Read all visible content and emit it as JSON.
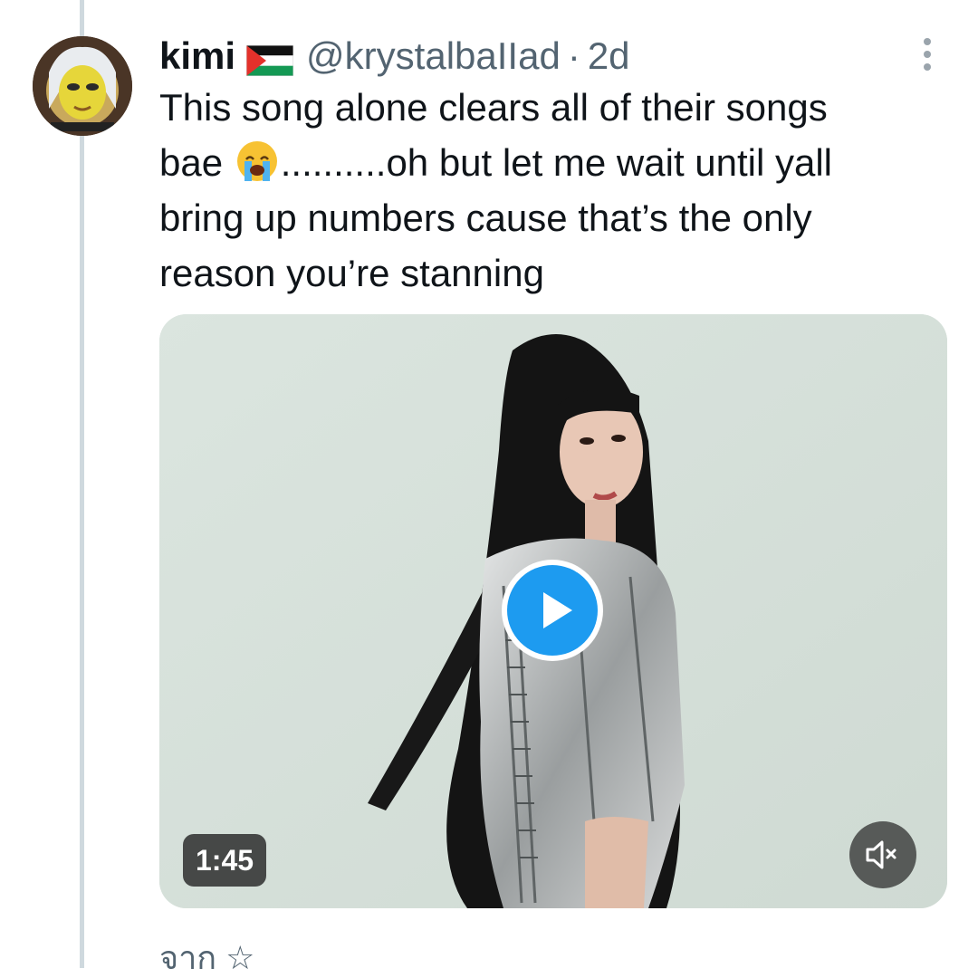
{
  "tweet": {
    "display_name": "kimi",
    "flag_icon": "palestine-flag-icon",
    "handle": "@krystalbaIIad",
    "separator": "·",
    "timestamp": "2d",
    "text_lines": [
      "This song alone clears all of their songs",
      "..........oh but let me wait until yall",
      "bring up numbers cause that’s the only",
      "reason you’re stanning"
    ],
    "text_line2_prefix": "bae",
    "emoji_icon": "loudly-crying-face-icon"
  },
  "media": {
    "duration": "1:45",
    "play_icon": "play-icon",
    "mute_icon": "muted-speaker-icon"
  },
  "footer": {
    "translate_text": "จาก ☆"
  },
  "colors": {
    "accent": "#1d9bf0",
    "text": "#0f1419",
    "secondary_text": "#536471",
    "thread_line": "#cfd9de"
  }
}
